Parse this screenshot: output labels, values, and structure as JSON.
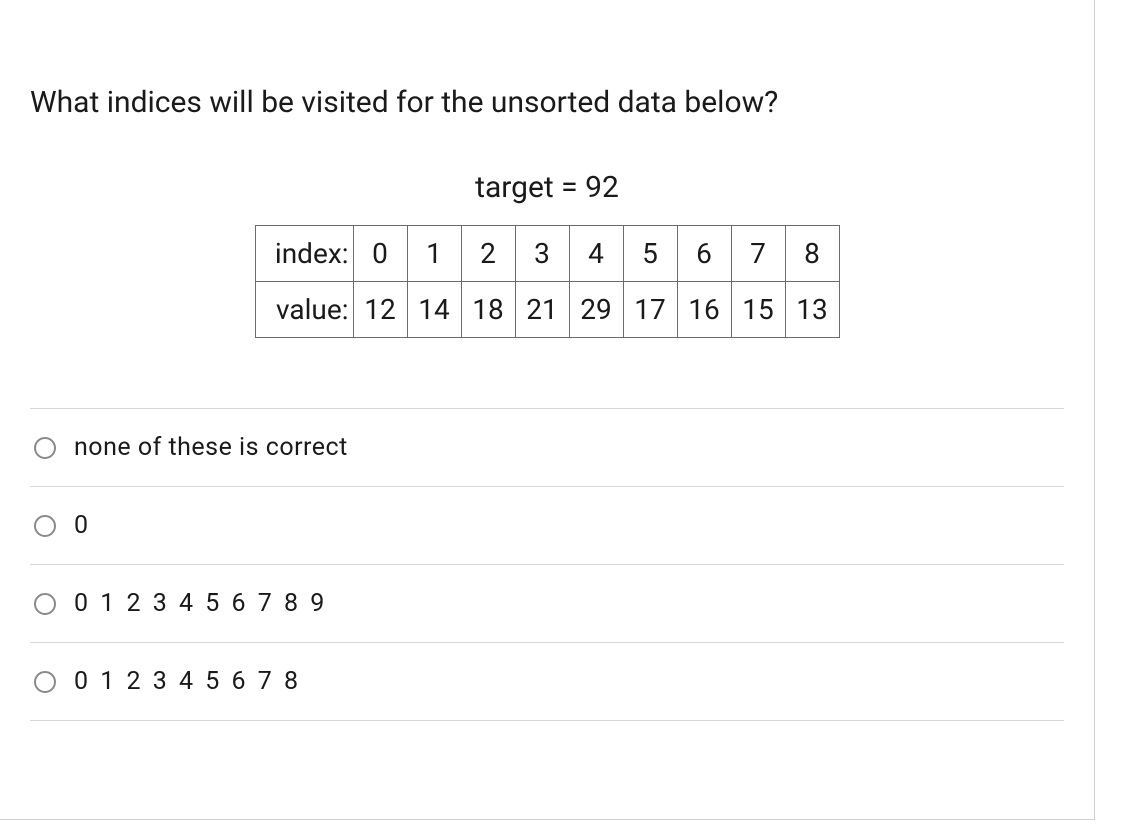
{
  "question": "What indices will be visited for the unsorted data below?",
  "target_label": "target = 92",
  "table": {
    "row1_label": "index:",
    "row1": [
      "0",
      "1",
      "2",
      "3",
      "4",
      "5",
      "6",
      "7",
      "8"
    ],
    "row2_label": "value:",
    "row2": [
      "12",
      "14",
      "18",
      "21",
      "29",
      "17",
      "16",
      "15",
      "13"
    ]
  },
  "options": [
    "none of these is correct",
    "0",
    "0 1 2 3 4 5 6 7 8 9",
    "0 1 2 3 4 5 6 7 8"
  ]
}
